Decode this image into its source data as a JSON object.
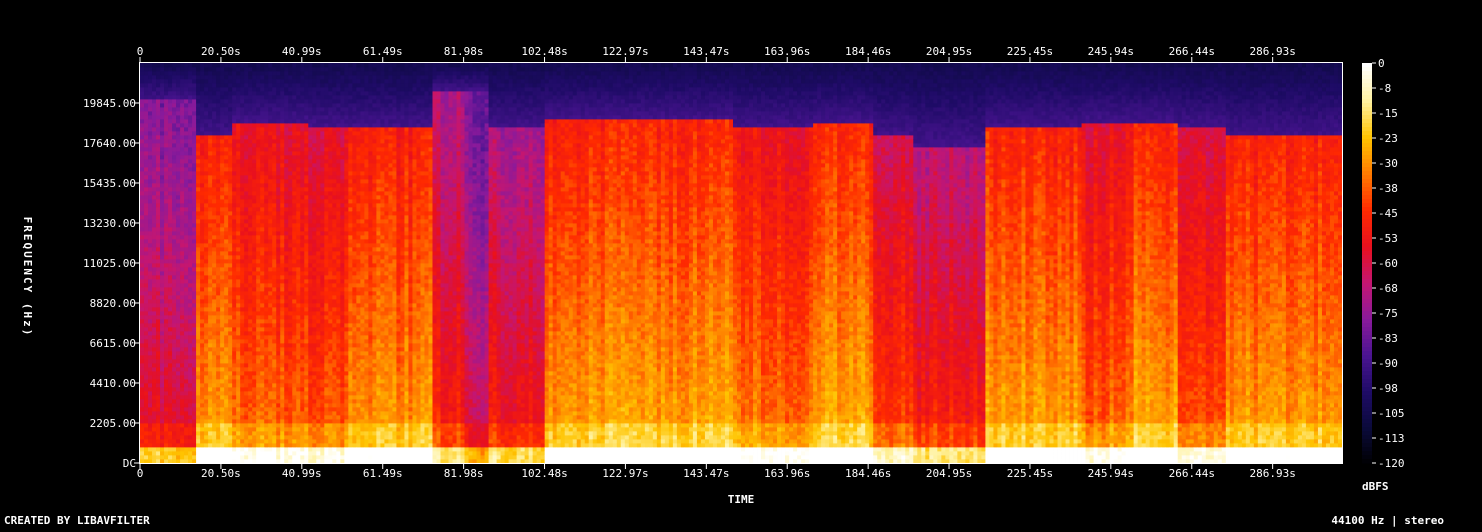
{
  "chart_data": {
    "type": "heatmap",
    "title": "",
    "xlabel": "TIME",
    "ylabel": "FREQUENCY (Hz)",
    "x_ticks": [
      "0",
      "20.50s",
      "40.99s",
      "61.49s",
      "81.98s",
      "102.48s",
      "122.97s",
      "143.47s",
      "163.96s",
      "184.46s",
      "204.95s",
      "225.45s",
      "245.94s",
      "266.44s",
      "286.93s"
    ],
    "x_tick_values_s": [
      0,
      20.5,
      40.99,
      61.49,
      81.98,
      102.48,
      122.97,
      143.47,
      163.96,
      184.46,
      204.95,
      225.45,
      245.94,
      266.44,
      286.93
    ],
    "x_range_s": [
      0,
      304.5
    ],
    "y_ticks": [
      "DC",
      "2205.00",
      "4410.00",
      "6615.00",
      "8820.00",
      "11025.00",
      "13230.00",
      "15435.00",
      "17640.00",
      "19845.00"
    ],
    "y_tick_values_hz": [
      0,
      2205,
      4410,
      6615,
      8820,
      11025,
      13230,
      15435,
      17640,
      19845
    ],
    "y_range_hz": [
      0,
      22050
    ],
    "colorbar": {
      "unit": "dBFS",
      "ticks": [
        "0",
        "-8",
        "-15",
        "-23",
        "-30",
        "-38",
        "-45",
        "-53",
        "-60",
        "-68",
        "-75",
        "-83",
        "-90",
        "-98",
        "-105",
        "-113",
        "-120"
      ],
      "range_db": [
        -120,
        0
      ],
      "colors": [
        "#000000",
        "#0a0a3a",
        "#1e0b66",
        "#4a1491",
        "#8a1a9b",
        "#c41672",
        "#e8101e",
        "#ff2a00",
        "#ff7a00",
        "#ffc400",
        "#fff2a0",
        "#ffffff"
      ]
    },
    "segments": [
      {
        "t_start": 0,
        "t_end": 14,
        "level": 0.55,
        "cutoff_hz": 20000
      },
      {
        "t_start": 14,
        "t_end": 23,
        "level": 0.78,
        "cutoff_hz": 18000
      },
      {
        "t_start": 23,
        "t_end": 43,
        "level": 0.72,
        "cutoff_hz": 18800
      },
      {
        "t_start": 43,
        "t_end": 53,
        "level": 0.7,
        "cutoff_hz": 18500
      },
      {
        "t_start": 53,
        "t_end": 74,
        "level": 0.78,
        "cutoff_hz": 18500
      },
      {
        "t_start": 74,
        "t_end": 82,
        "level": 0.62,
        "cutoff_hz": 20500
      },
      {
        "t_start": 82,
        "t_end": 88,
        "level": 0.52,
        "cutoff_hz": 20500
      },
      {
        "t_start": 88,
        "t_end": 103,
        "level": 0.6,
        "cutoff_hz": 18500
      },
      {
        "t_start": 103,
        "t_end": 150,
        "level": 0.8,
        "cutoff_hz": 19000
      },
      {
        "t_start": 150,
        "t_end": 171,
        "level": 0.74,
        "cutoff_hz": 18500
      },
      {
        "t_start": 171,
        "t_end": 186,
        "level": 0.8,
        "cutoff_hz": 18800
      },
      {
        "t_start": 186,
        "t_end": 196,
        "level": 0.68,
        "cutoff_hz": 18000
      },
      {
        "t_start": 196,
        "t_end": 214,
        "level": 0.62,
        "cutoff_hz": 17500
      },
      {
        "t_start": 214,
        "t_end": 239,
        "level": 0.8,
        "cutoff_hz": 18500
      },
      {
        "t_start": 239,
        "t_end": 252,
        "level": 0.72,
        "cutoff_hz": 18800
      },
      {
        "t_start": 252,
        "t_end": 263,
        "level": 0.8,
        "cutoff_hz": 18800
      },
      {
        "t_start": 263,
        "t_end": 275,
        "level": 0.7,
        "cutoff_hz": 18500
      },
      {
        "t_start": 275,
        "t_end": 304.5,
        "level": 0.78,
        "cutoff_hz": 18000
      }
    ],
    "grid": false
  },
  "footer": {
    "credit": "CREATED BY LIBAVFILTER",
    "info": "44100 Hz | stereo"
  }
}
